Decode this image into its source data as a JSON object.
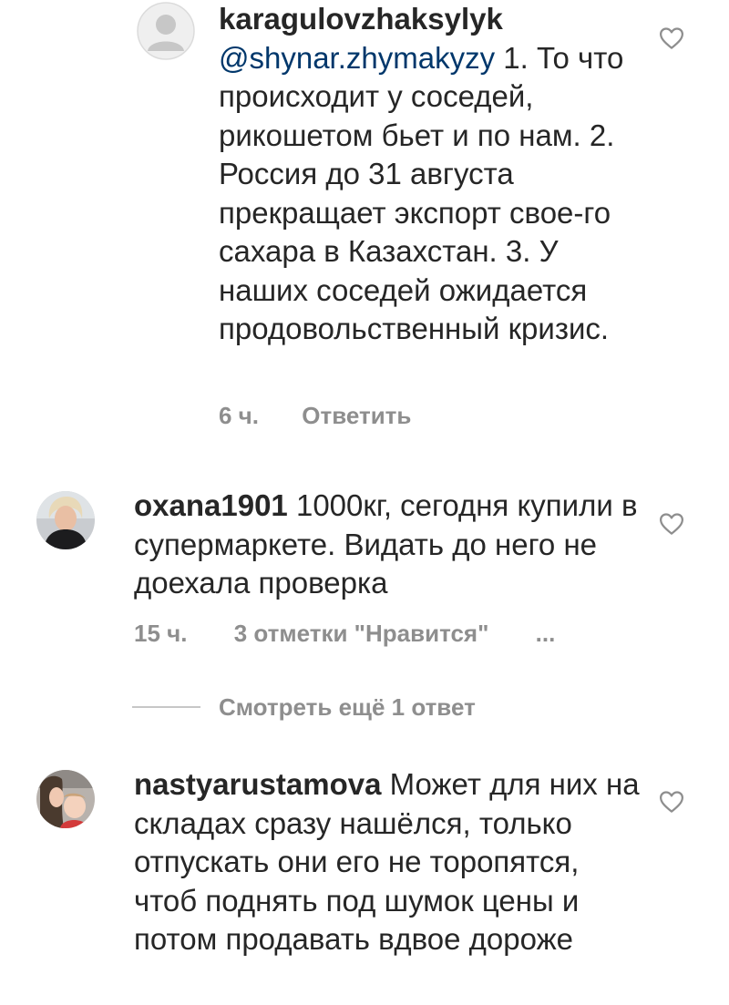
{
  "comments": [
    {
      "username": "karagulovzhaksylyk",
      "mention": "@shynar.zhymakyzy",
      "text": "1. То что происходит у соседей, рикошетом бьет и по нам. 2.  Россия до 31 августа прекращает экспорт свое-го сахара в Казахстан. 3. У наших соседей ожидается продовольственный кризис.",
      "time": "6 ч.",
      "reply": "Ответить",
      "avatar": "default-avatar"
    },
    {
      "username": "oxana1901",
      "text": "1000кг, сегодня купили в супермаркете. Видать до него не доехала проверка",
      "time": "15 ч.",
      "likes": "3 отметки \"Нравится\"",
      "more": "...",
      "avatar": "user-photo"
    },
    {
      "username": "nastyarustamova",
      "text": "Может для них на складах сразу нашёлся, только отпускать они его не торопятся, чтоб поднять под шумок цены и потом продавать вдвое дороже",
      "avatar": "user-photo"
    }
  ],
  "view_replies": "Смотреть ещё 1 ответ",
  "colors": {
    "text": "#262626",
    "meta": "#8e8e8e",
    "mention": "#00376b",
    "divider": "#c7c7c7"
  },
  "icons": {
    "like": "heart-outline-icon",
    "default_avatar": "default-avatar-icon"
  }
}
